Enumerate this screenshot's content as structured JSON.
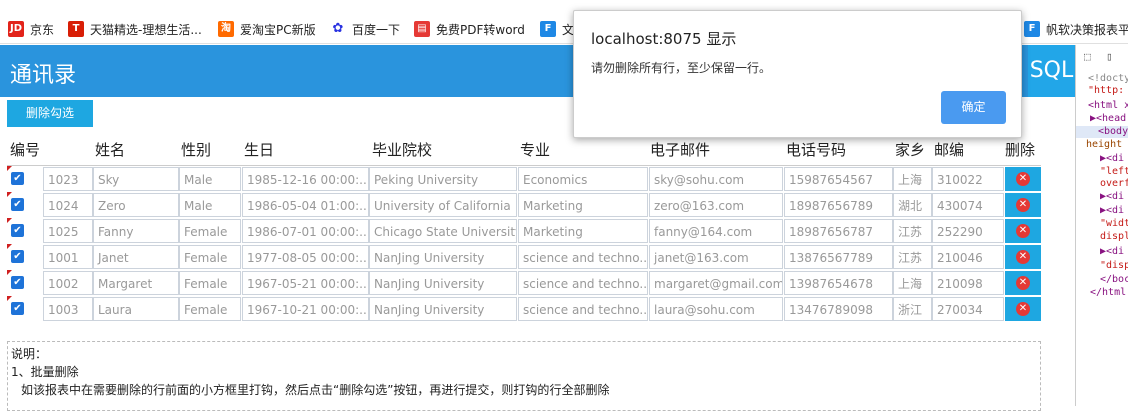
{
  "bookmarks": [
    {
      "label": "京东",
      "icon": "jd-icon",
      "color": "#e2231a",
      "glyph": "JD"
    },
    {
      "label": "天猫精选-理想生活...",
      "icon": "tmall-icon",
      "color": "#d81e06",
      "glyph": "T"
    },
    {
      "label": "爱淘宝PC新版",
      "icon": "aitaobao-icon",
      "color": "#ff6a00",
      "glyph": "淘"
    },
    {
      "label": "百度一下",
      "icon": "baidu-paw-icon",
      "color": "#2932e1",
      "glyph": "✿"
    },
    {
      "label": "免费PDF转word",
      "icon": "pdf-icon",
      "color": "#e53935",
      "glyph": "▤"
    },
    {
      "label": "文",
      "icon": "fanruan-icon",
      "color": "#1e88e5",
      "glyph": "F"
    },
    {
      "label": "帆软决策报表平",
      "icon": "fanruan-icon",
      "color": "#1e88e5",
      "glyph": "F"
    }
  ],
  "app": {
    "title": "通讯录",
    "sql_label": "SQL",
    "delete_checked_label": "删除勾选"
  },
  "table": {
    "columns": [
      "编号",
      "姓名",
      "性别",
      "生日",
      "毕业院校",
      "专业",
      "电子邮件",
      "电话号码",
      "家乡",
      "邮编",
      "删除"
    ],
    "rows": [
      [
        "1023",
        "Sky",
        "Male",
        "1985-12-16 00:00:...",
        "Peking University",
        "Economics",
        "sky@sohu.com",
        "15987654567",
        "上海",
        "310022"
      ],
      [
        "1024",
        "Zero",
        "Male",
        "1986-05-04 01:00:...",
        "University of California",
        "Marketing",
        "zero@163.com",
        "18987656789",
        "湖北",
        "430074"
      ],
      [
        "1025",
        "Fanny",
        "Female",
        "1986-07-01 00:00:...",
        "Chicago State University",
        "Marketing",
        "fanny@164.com",
        "18987656787",
        "江苏",
        "252290"
      ],
      [
        "1001",
        "Janet",
        "Female",
        "1977-08-05 00:00:...",
        "NanJing University",
        "science and techno...",
        "janet@163.com",
        "13876567789",
        "江苏",
        "210046"
      ],
      [
        "1002",
        "Margaret",
        "Female",
        "1967-05-21 00:00:...",
        "NanJing University",
        "science and techno...",
        "margaret@gmail.com",
        "13987654678",
        "上海",
        "210098"
      ],
      [
        "1003",
        "Laura",
        "Female",
        "1967-10-21 00:00:...",
        "NanJing University",
        "science and techno...",
        "laura@sohu.com",
        "13476789098",
        "浙江",
        "270034"
      ]
    ]
  },
  "notes": {
    "line1": "说明：",
    "line2": "1、批量删除",
    "line3": "如该报表中在需要删除的行前面的小方框里打钩，然后点击“删除勾选”按钮，再进行提交，则打钩的行全部删除"
  },
  "dialog": {
    "title": "localhost:8075 显示",
    "message": "请勿删除所有行，至少保留一行。",
    "ok_label": "确定"
  },
  "devtools": {
    "lines": [
      "<!docty",
      "\"http:",
      "<html x",
      "▶<head",
      "<body",
      "height",
      "▶<di",
      "\"left",
      "overf",
      "▶<di",
      "▶<di",
      "\"widt",
      "displ",
      "▶<di",
      "\"disp",
      "</boc",
      "</html"
    ]
  },
  "colors": {
    "header_bg": "#2a94dd",
    "button_bg": "#1ea7e1",
    "delete_icon": "#e53935",
    "dialog_ok": "#4a9af0"
  }
}
